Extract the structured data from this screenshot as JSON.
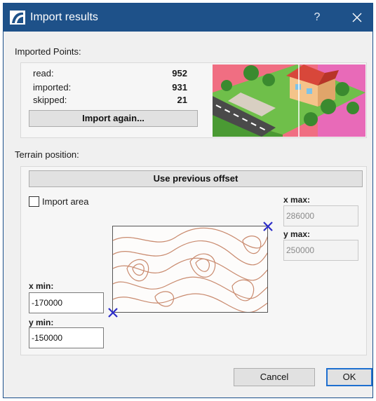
{
  "window": {
    "title": "Import results",
    "help_label": "?",
    "accent": "#1e5189"
  },
  "imported_points": {
    "section_label": "Imported Points:",
    "read_label": "read:",
    "read_value": "952",
    "imported_label": "imported:",
    "imported_value": "931",
    "skipped_label": "skipped:",
    "skipped_value": "21",
    "import_again_label": "Import again..."
  },
  "terrain_position": {
    "section_label": "Terrain position:",
    "use_previous_offset_label": "Use previous offset",
    "import_area_label": "Import area",
    "import_area_checked": false,
    "x_max_label": "x max:",
    "x_max_value": "286000",
    "y_max_label": "y max:",
    "y_max_value": "250000",
    "x_min_label": "x min:",
    "x_min_value": "-170000",
    "y_min_label": "y min:",
    "y_min_value": "-150000",
    "marker_color": "#2c2cc8"
  },
  "footer": {
    "cancel_label": "Cancel",
    "ok_label": "OK"
  }
}
